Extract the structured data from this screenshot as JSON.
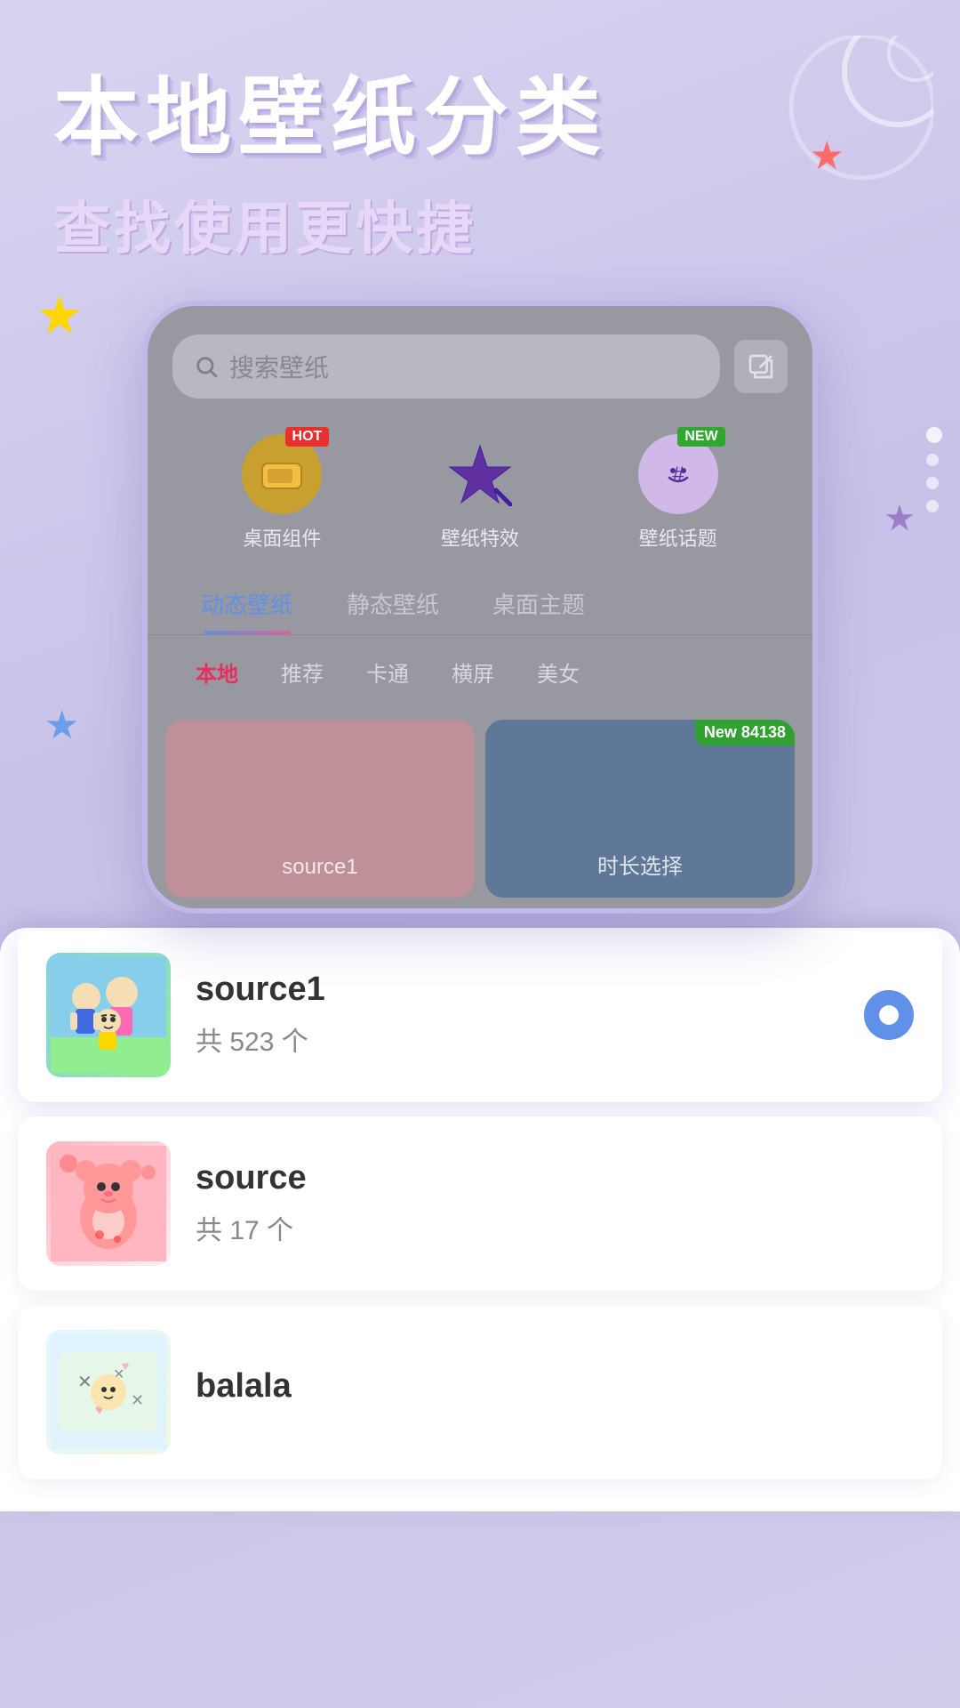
{
  "page": {
    "title_main": "本地壁纸分类",
    "title_sub": "查找使用更快捷"
  },
  "search": {
    "placeholder": "搜索壁纸"
  },
  "features": [
    {
      "id": "desktop-widgets",
      "label": "桌面组件",
      "badge": "HOT",
      "badge_type": "hot"
    },
    {
      "id": "wallpaper-effects",
      "label": "壁纸特效",
      "badge": null,
      "badge_type": null
    },
    {
      "id": "wallpaper-topics",
      "label": "壁纸话题",
      "badge": "NEW",
      "badge_type": "new"
    }
  ],
  "tabs": [
    {
      "id": "dynamic",
      "label": "动态壁纸",
      "active": true
    },
    {
      "id": "static",
      "label": "静态壁纸",
      "active": false
    },
    {
      "id": "themes",
      "label": "桌面主题",
      "active": false
    }
  ],
  "subtabs": [
    {
      "id": "local",
      "label": "本地",
      "active": true
    },
    {
      "id": "recommend",
      "label": "推荐",
      "active": false
    },
    {
      "id": "cartoon",
      "label": "卡通",
      "active": false
    },
    {
      "id": "landscape",
      "label": "横屏",
      "active": false
    },
    {
      "id": "beauty",
      "label": "美女",
      "active": false
    }
  ],
  "grid_cards": [
    {
      "id": "source1-card",
      "label": "source1",
      "color": "pink"
    },
    {
      "id": "duration-card",
      "label": "时长选择",
      "color": "blue"
    }
  ],
  "sources": [
    {
      "id": "source1",
      "name": "source1",
      "count_label": "共 523 个",
      "selected": true,
      "thumb_type": "shinchan"
    },
    {
      "id": "source",
      "name": "source",
      "count_label": "共 17 个",
      "selected": false,
      "thumb_type": "lotso"
    },
    {
      "id": "balala",
      "name": "balala",
      "count_label": "",
      "selected": false,
      "thumb_type": "balala"
    }
  ],
  "new_badge_text": "New 84138",
  "export_icon": "↗",
  "radio_selected_icon": "●"
}
